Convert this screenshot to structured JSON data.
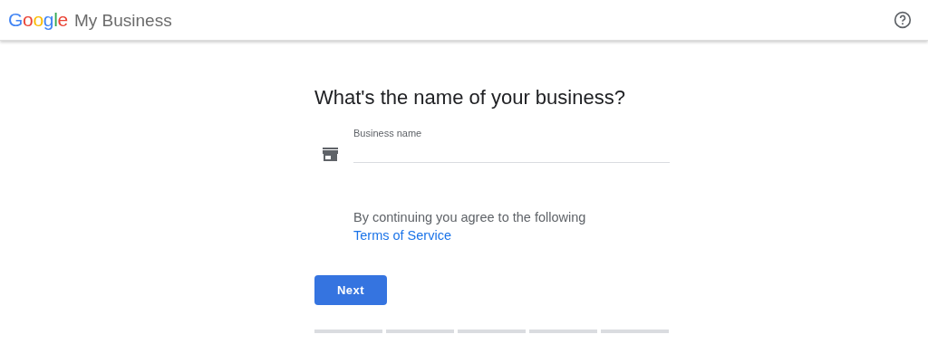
{
  "header": {
    "logo": "Google",
    "product": "My Business"
  },
  "heading": "What's the name of your business?",
  "field": {
    "label": "Business name"
  },
  "terms": {
    "text": "By continuing you agree to the following",
    "link": "Terms of Service"
  },
  "next_button": "Next",
  "progress_steps": [
    {
      "done": false
    },
    {
      "done": false
    },
    {
      "done": false
    },
    {
      "done": false
    },
    {
      "done": false
    }
  ]
}
